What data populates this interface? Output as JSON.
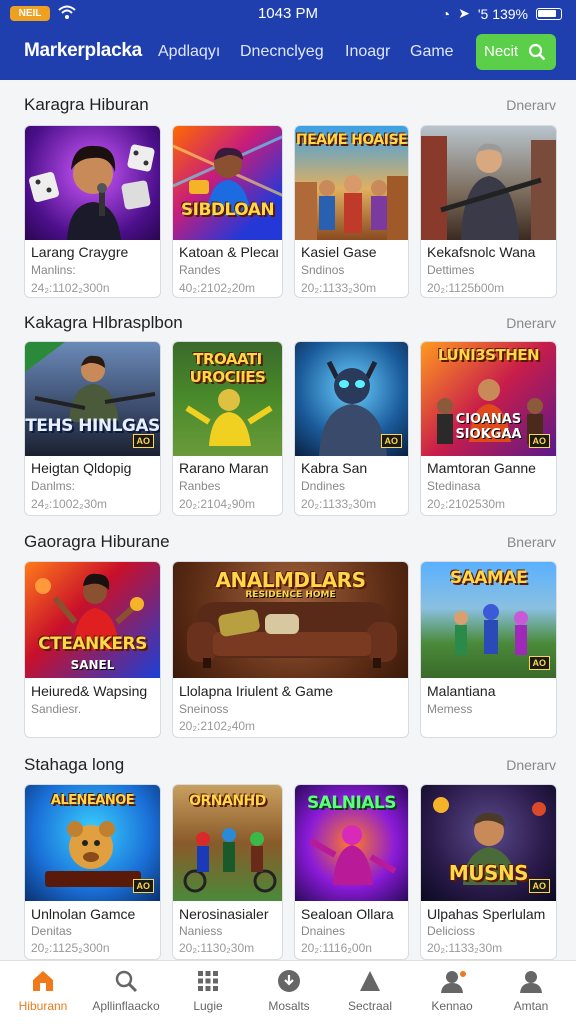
{
  "status_bar": {
    "pill_label": "NEIL",
    "time": "1043 PM",
    "battery_text": "'5 139%"
  },
  "header": {
    "brand": "Markerplacka",
    "nav": [
      "Apdlaqyı",
      "Dnecnclyeg",
      "Inoagr",
      "Game"
    ],
    "next_button": "Necit",
    "icons": {
      "search": "search-icon"
    }
  },
  "sections": [
    {
      "title": "Karagra Hiburan",
      "see_all": "Dnerarv",
      "cards": [
        {
          "title": "Larang Craygre",
          "sub": "Manlins:",
          "meta": "24₂:1102₂300n",
          "thumb_text": "",
          "thumb_sub": ""
        },
        {
          "title": "Katoan & Plecan",
          "sub": "Randes",
          "meta": "40₂:2102₂20m",
          "thumb_text": "SIBDLOAN",
          "thumb_sub": ""
        },
        {
          "title": "Kasiel Gase",
          "sub": "Sndinos",
          "meta": "20₂:1133₂30m",
          "thumb_text": "ПEAИE HOAISE",
          "thumb_sub": ""
        },
        {
          "title": "Kekafsnolc Wana",
          "sub": "Dettimes",
          "meta": "20₂:1125ɓ00m",
          "thumb_text": "",
          "thumb_sub": ""
        }
      ]
    },
    {
      "title": "Kakagra Hlbrasplbon",
      "see_all": "Dnerarv",
      "cards": [
        {
          "title": "Heigtan Qldopig",
          "sub": "Danlms:",
          "meta": "24₂:1002₂30m",
          "thumb_text": "TEHS HINLGAS",
          "thumb_sub": ""
        },
        {
          "title": "Rarano Maran",
          "sub": "Ranbes",
          "meta": "20₂:2104₂90m",
          "thumb_text": "TROAATI UROCIIES",
          "thumb_sub": ""
        },
        {
          "title": "Kabra San",
          "sub": "Dndines",
          "meta": "20₂:1133₂30m",
          "thumb_text": "",
          "thumb_sub": ""
        },
        {
          "title": "Mamtoran Ganne",
          "sub": "Stedinasa",
          "meta": "20₂:2102530m",
          "thumb_text": "LUNI3STHEN",
          "thumb_sub": "CIOANAS SIOKGAA"
        }
      ]
    },
    {
      "title": "Gaoragra Hiburane",
      "see_all": "Bnerarv",
      "cards": [
        {
          "title": "Heiured& Wapsing",
          "sub": "Sandiesr.",
          "meta": "",
          "thumb_text": "CTEANKERS",
          "thumb_sub": "SANEL"
        },
        {
          "title": "Llolapna Iriulent & Game",
          "sub": "Sneinoss",
          "meta": "20₂:2102₂40m",
          "thumb_text": "ANALMDLARS",
          "thumb_sub": "RESIDENCE HOME"
        },
        {
          "title": "Malantiana",
          "sub": "Memess",
          "meta": "",
          "thumb_text": "SAAMAE",
          "thumb_sub": ""
        }
      ]
    },
    {
      "title": "Stahaga long",
      "see_all": "Dnerarv",
      "cards": [
        {
          "title": "Unlnolan Gamce",
          "sub": "Denitas",
          "meta": "20₂:1125₂300n",
          "thumb_text": "ALENEANOE",
          "thumb_sub": ""
        },
        {
          "title": "Nerosinasialer",
          "sub": "Naniess",
          "meta": "20₂:1130₂30m",
          "thumb_text": "ORNANHD",
          "thumb_sub": ""
        },
        {
          "title": "Sealoan Ollara",
          "sub": "Dnaines",
          "meta": "20₂:1116₂00n",
          "thumb_text": "SALNIALS",
          "thumb_sub": ""
        },
        {
          "title": "Ulpahas Sperlulam",
          "sub": "Delicioss",
          "meta": "20₂:1133₂30m",
          "thumb_text": "MUSNS",
          "thumb_sub": ""
        }
      ]
    }
  ],
  "bottom_nav": [
    {
      "label": "Hiburann",
      "icon": "home-icon",
      "active": true
    },
    {
      "label": "Apllinflaacko",
      "icon": "search-icon",
      "active": false
    },
    {
      "label": "Lugie",
      "icon": "grid-icon",
      "active": false
    },
    {
      "label": "Mosalts",
      "icon": "download-icon",
      "active": false
    },
    {
      "label": "Sectraal",
      "icon": "triangle-icon",
      "active": false
    },
    {
      "label": "Kennao",
      "icon": "profile-notification-icon",
      "active": false
    },
    {
      "label": "Amtan",
      "icon": "person-icon",
      "active": false
    }
  ],
  "colors": {
    "header_bg": "#1f3fae",
    "accent_green": "#5ccf4a",
    "active_orange": "#f07a1a"
  }
}
